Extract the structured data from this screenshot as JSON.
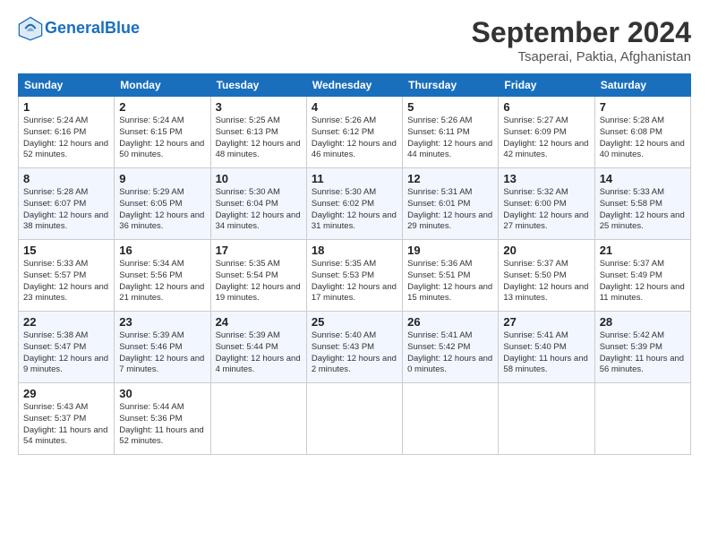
{
  "header": {
    "logo_line1": "General",
    "logo_line2": "Blue",
    "month_title": "September 2024",
    "location": "Tsaperai, Paktia, Afghanistan"
  },
  "columns": [
    "Sunday",
    "Monday",
    "Tuesday",
    "Wednesday",
    "Thursday",
    "Friday",
    "Saturday"
  ],
  "weeks": [
    [
      {
        "day": "1",
        "sunrise": "Sunrise: 5:24 AM",
        "sunset": "Sunset: 6:16 PM",
        "daylight": "Daylight: 12 hours and 52 minutes."
      },
      {
        "day": "2",
        "sunrise": "Sunrise: 5:24 AM",
        "sunset": "Sunset: 6:15 PM",
        "daylight": "Daylight: 12 hours and 50 minutes."
      },
      {
        "day": "3",
        "sunrise": "Sunrise: 5:25 AM",
        "sunset": "Sunset: 6:13 PM",
        "daylight": "Daylight: 12 hours and 48 minutes."
      },
      {
        "day": "4",
        "sunrise": "Sunrise: 5:26 AM",
        "sunset": "Sunset: 6:12 PM",
        "daylight": "Daylight: 12 hours and 46 minutes."
      },
      {
        "day": "5",
        "sunrise": "Sunrise: 5:26 AM",
        "sunset": "Sunset: 6:11 PM",
        "daylight": "Daylight: 12 hours and 44 minutes."
      },
      {
        "day": "6",
        "sunrise": "Sunrise: 5:27 AM",
        "sunset": "Sunset: 6:09 PM",
        "daylight": "Daylight: 12 hours and 42 minutes."
      },
      {
        "day": "7",
        "sunrise": "Sunrise: 5:28 AM",
        "sunset": "Sunset: 6:08 PM",
        "daylight": "Daylight: 12 hours and 40 minutes."
      }
    ],
    [
      {
        "day": "8",
        "sunrise": "Sunrise: 5:28 AM",
        "sunset": "Sunset: 6:07 PM",
        "daylight": "Daylight: 12 hours and 38 minutes."
      },
      {
        "day": "9",
        "sunrise": "Sunrise: 5:29 AM",
        "sunset": "Sunset: 6:05 PM",
        "daylight": "Daylight: 12 hours and 36 minutes."
      },
      {
        "day": "10",
        "sunrise": "Sunrise: 5:30 AM",
        "sunset": "Sunset: 6:04 PM",
        "daylight": "Daylight: 12 hours and 34 minutes."
      },
      {
        "day": "11",
        "sunrise": "Sunrise: 5:30 AM",
        "sunset": "Sunset: 6:02 PM",
        "daylight": "Daylight: 12 hours and 31 minutes."
      },
      {
        "day": "12",
        "sunrise": "Sunrise: 5:31 AM",
        "sunset": "Sunset: 6:01 PM",
        "daylight": "Daylight: 12 hours and 29 minutes."
      },
      {
        "day": "13",
        "sunrise": "Sunrise: 5:32 AM",
        "sunset": "Sunset: 6:00 PM",
        "daylight": "Daylight: 12 hours and 27 minutes."
      },
      {
        "day": "14",
        "sunrise": "Sunrise: 5:33 AM",
        "sunset": "Sunset: 5:58 PM",
        "daylight": "Daylight: 12 hours and 25 minutes."
      }
    ],
    [
      {
        "day": "15",
        "sunrise": "Sunrise: 5:33 AM",
        "sunset": "Sunset: 5:57 PM",
        "daylight": "Daylight: 12 hours and 23 minutes."
      },
      {
        "day": "16",
        "sunrise": "Sunrise: 5:34 AM",
        "sunset": "Sunset: 5:56 PM",
        "daylight": "Daylight: 12 hours and 21 minutes."
      },
      {
        "day": "17",
        "sunrise": "Sunrise: 5:35 AM",
        "sunset": "Sunset: 5:54 PM",
        "daylight": "Daylight: 12 hours and 19 minutes."
      },
      {
        "day": "18",
        "sunrise": "Sunrise: 5:35 AM",
        "sunset": "Sunset: 5:53 PM",
        "daylight": "Daylight: 12 hours and 17 minutes."
      },
      {
        "day": "19",
        "sunrise": "Sunrise: 5:36 AM",
        "sunset": "Sunset: 5:51 PM",
        "daylight": "Daylight: 12 hours and 15 minutes."
      },
      {
        "day": "20",
        "sunrise": "Sunrise: 5:37 AM",
        "sunset": "Sunset: 5:50 PM",
        "daylight": "Daylight: 12 hours and 13 minutes."
      },
      {
        "day": "21",
        "sunrise": "Sunrise: 5:37 AM",
        "sunset": "Sunset: 5:49 PM",
        "daylight": "Daylight: 12 hours and 11 minutes."
      }
    ],
    [
      {
        "day": "22",
        "sunrise": "Sunrise: 5:38 AM",
        "sunset": "Sunset: 5:47 PM",
        "daylight": "Daylight: 12 hours and 9 minutes."
      },
      {
        "day": "23",
        "sunrise": "Sunrise: 5:39 AM",
        "sunset": "Sunset: 5:46 PM",
        "daylight": "Daylight: 12 hours and 7 minutes."
      },
      {
        "day": "24",
        "sunrise": "Sunrise: 5:39 AM",
        "sunset": "Sunset: 5:44 PM",
        "daylight": "Daylight: 12 hours and 4 minutes."
      },
      {
        "day": "25",
        "sunrise": "Sunrise: 5:40 AM",
        "sunset": "Sunset: 5:43 PM",
        "daylight": "Daylight: 12 hours and 2 minutes."
      },
      {
        "day": "26",
        "sunrise": "Sunrise: 5:41 AM",
        "sunset": "Sunset: 5:42 PM",
        "daylight": "Daylight: 12 hours and 0 minutes."
      },
      {
        "day": "27",
        "sunrise": "Sunrise: 5:41 AM",
        "sunset": "Sunset: 5:40 PM",
        "daylight": "Daylight: 11 hours and 58 minutes."
      },
      {
        "day": "28",
        "sunrise": "Sunrise: 5:42 AM",
        "sunset": "Sunset: 5:39 PM",
        "daylight": "Daylight: 11 hours and 56 minutes."
      }
    ],
    [
      {
        "day": "29",
        "sunrise": "Sunrise: 5:43 AM",
        "sunset": "Sunset: 5:37 PM",
        "daylight": "Daylight: 11 hours and 54 minutes."
      },
      {
        "day": "30",
        "sunrise": "Sunrise: 5:44 AM",
        "sunset": "Sunset: 5:36 PM",
        "daylight": "Daylight: 11 hours and 52 minutes."
      },
      null,
      null,
      null,
      null,
      null
    ]
  ]
}
